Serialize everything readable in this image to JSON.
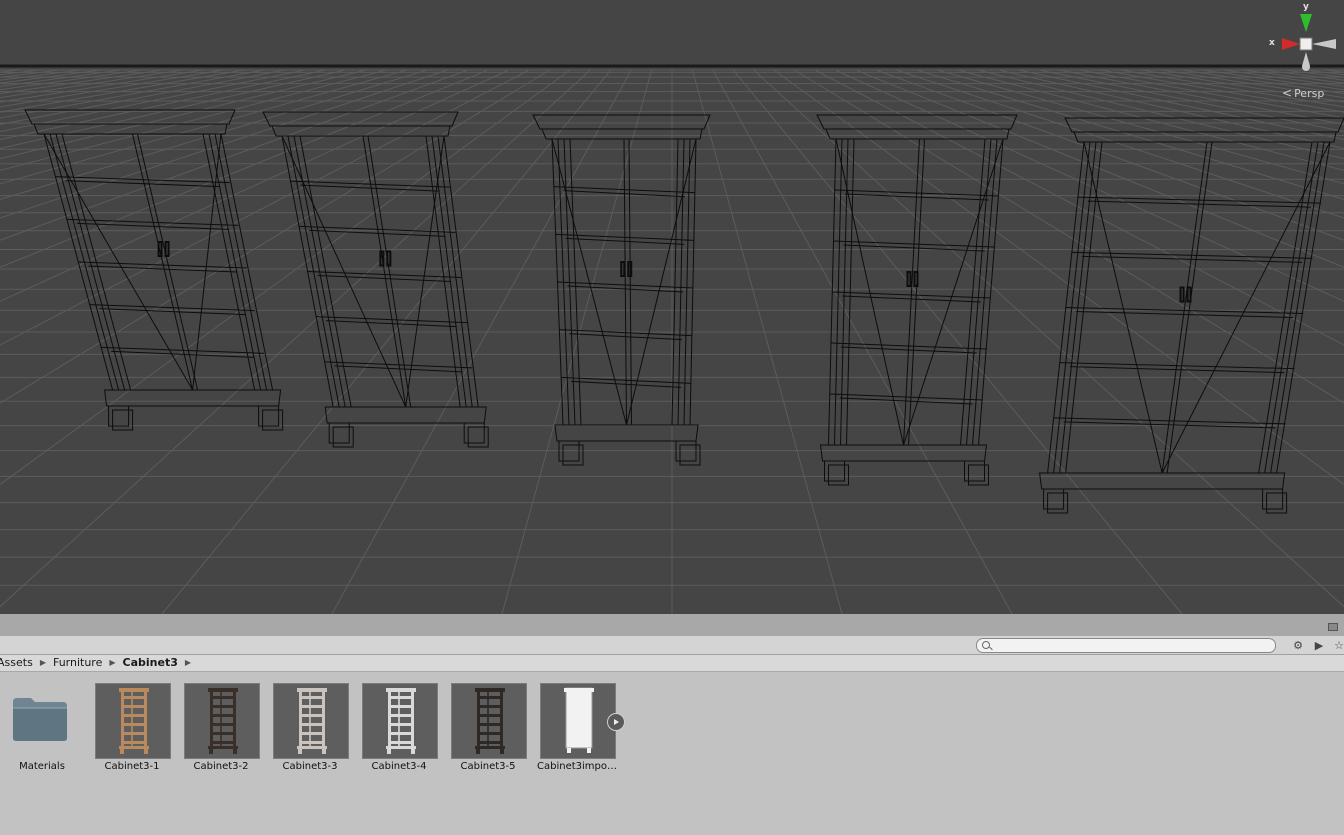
{
  "scene": {
    "background_color": "#454545",
    "grid_color": "#5c5c5c",
    "wire_color": "#0d0d0d",
    "projection_label": "Persp",
    "projection_icon": "chevron-left-icon",
    "object_count": 5,
    "gizmo": {
      "x_axis_label": "x",
      "y_axis_label": "y",
      "x_color": "#d42a2a",
      "y_color": "#2fbd2f",
      "z_color": "#c8c8c8"
    }
  },
  "project": {
    "search": {
      "value": "",
      "placeholder": ""
    },
    "toolbar_icons": [
      "create-icon",
      "label-icon",
      "favorite-star-icon"
    ],
    "lock_icon": "lock-icon",
    "breadcrumb": [
      "Assets",
      "Furniture",
      "Cabinet3"
    ],
    "assets": [
      {
        "name": "Materials",
        "kind": "folder",
        "icon": "folder-icon"
      },
      {
        "name": "Cabinet3-1",
        "kind": "prefab",
        "color": "#b88a5e"
      },
      {
        "name": "Cabinet3-2",
        "kind": "prefab",
        "color": "#3a2f28"
      },
      {
        "name": "Cabinet3-3",
        "kind": "prefab",
        "color": "#cbc4bc"
      },
      {
        "name": "Cabinet3-4",
        "kind": "prefab",
        "color": "#d9d9d9"
      },
      {
        "name": "Cabinet3-5",
        "kind": "prefab",
        "color": "#2f2926"
      },
      {
        "name": "Cabinet3impo…",
        "kind": "model",
        "color": "#f2f2f2",
        "expand_icon": "expand-arrow-icon"
      }
    ]
  }
}
